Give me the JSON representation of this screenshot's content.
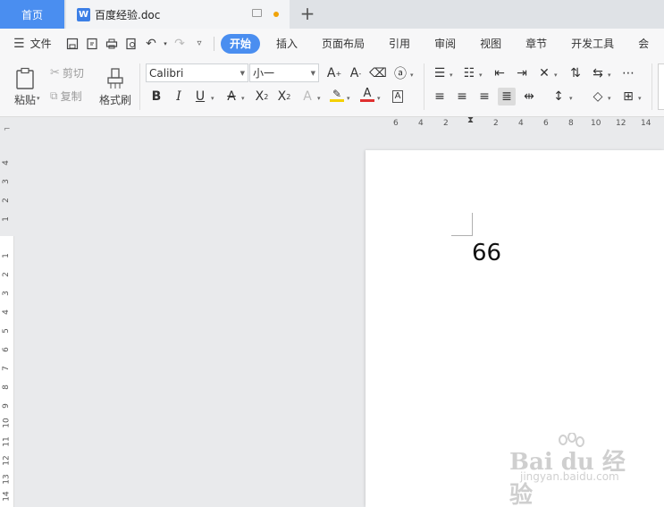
{
  "tabs": {
    "home": "首页",
    "doc_title": "百度经验.doc",
    "doc_icon": "W",
    "add": "+"
  },
  "menu": {
    "file": "文件",
    "tabs": [
      "开始",
      "插入",
      "页面布局",
      "引用",
      "审阅",
      "视图",
      "章节",
      "开发工具",
      "会"
    ],
    "active_tab": "开始"
  },
  "ribbon": {
    "paste": "粘贴",
    "cut": "剪切",
    "copy": "复制",
    "format_painter": "格式刷",
    "font_name": "Calibri",
    "font_size": "小一",
    "font_color_letter": "A",
    "highlight_letter": "A"
  },
  "ruler": {
    "h": [
      "6",
      "4",
      "2",
      "2",
      "4",
      "6",
      "8",
      "10",
      "12",
      "14"
    ],
    "v_top": [
      "4",
      "3",
      "2",
      "1"
    ],
    "v_bottom": [
      "1",
      "2",
      "3",
      "4",
      "5",
      "6",
      "7",
      "8",
      "9",
      "10",
      "11",
      "12",
      "13",
      "14"
    ]
  },
  "document": {
    "text": "66"
  },
  "watermark": {
    "logo": "Bai du 经验",
    "url": "jingyan.baidu.com"
  },
  "colors": {
    "accent": "#4a8ef0",
    "font_color_bar": "#e03030",
    "highlight_bar": "#f4d000"
  }
}
